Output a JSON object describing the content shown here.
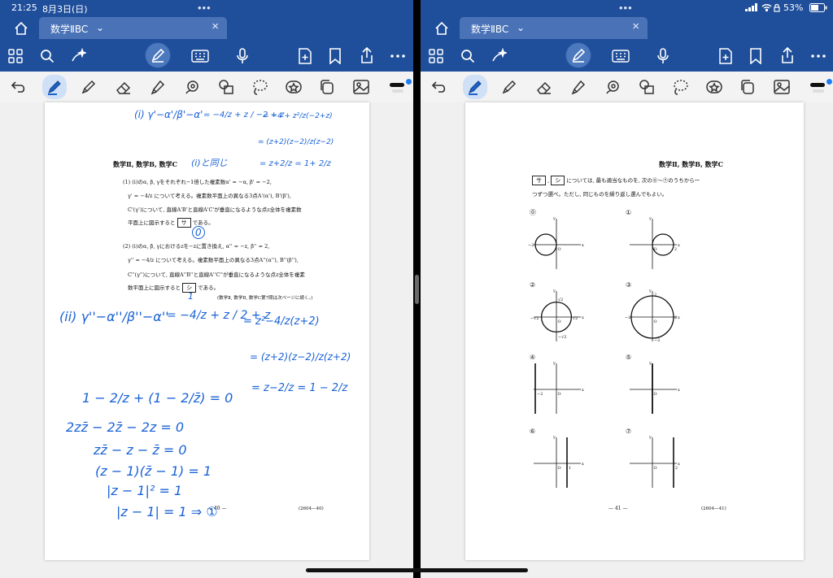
{
  "status_bar": {
    "time": "21:25",
    "date": "8月3日(日)",
    "battery": "53%"
  },
  "document": {
    "tab_title": "数学ⅡBC"
  },
  "left_page": {
    "header": "数学Ⅱ, 数学B, 数学C",
    "q1_line1": "(1) (i)のα, β, γをそれぞれ−1倍した複素数α' = −α, β' = −2,",
    "q1_line2": "γ' = −4/z について考える。複素数平面上の異なる3点A'(α'), B'(β'),",
    "q1_line3": "C'(γ')について, 直線A'B'と直線A'C'が垂直になるような点z全体を複素数",
    "q1_line4": "平面上に図示すると",
    "q1_box": "サ",
    "q1_end": "である。",
    "q2_line1": "(2) (i)のα, β, γにおけるzを−zに置き換え, α'' = −z, β'' = 2,",
    "q2_line2": "γ'' = −4/z について考える。複素数平面上の異なる3点A''(α''), B''(β''),",
    "q2_line3": "C''(γ'')について, 直線A''B''と直線A''C''が垂直になるような点z全体を複素",
    "q2_line4": "数平面上に図示すると",
    "q2_box": "シ",
    "q2_end": "である。",
    "note": "(数学Ⅱ, 数学B, 数学C第7問は次ページに続く。)",
    "page_number": "— 40 —",
    "code": "(2604—40)",
    "handwriting": {
      "top_left": "(i) γ'−α'/β'−α'",
      "top_mid": "= −4/z + z / −2 + z",
      "top_right": "= −4 + z²/z(−2+z)",
      "top_right2": "= (z+2)(z−2)/z(z−2)",
      "top_right3": "= z+2/z = 1+ 2/z",
      "beside_header": "(i)と同じ",
      "circle_answer": "0",
      "circle_answer2": "1",
      "mid_left": "(ii) γ''−α''/β''−α''",
      "mid_eq": "= −4/z + z / 2 + z",
      "mid_right": "= z²−4/z(z+2)",
      "mid_right2": "= (z+2)(z−2)/z(z+2)",
      "mid_right3": "= z−2/z = 1 − 2/z",
      "line1": "1 − 2/z + (1 − 2/z̄) = 0",
      "line2": "2zz̄ − 2z̄ − 2z = 0",
      "line3": "zz̄ − z − z̄ = 0",
      "line4": "(z − 1)(z̄ − 1) = 1",
      "line5": "|z − 1|² = 1",
      "line6": "|z − 1| = 1 ⇒ ①"
    }
  },
  "right_page": {
    "header": "数学Ⅱ, 数学B, 数学C",
    "instr_box1": "サ",
    "instr_box2": "シ",
    "instr_line1": "については, 最も適当なものを, 次の⓪〜⑦のうちから一",
    "instr_line2": "つずつ選べ。ただし, 同じものを繰り返し選んでもよい。",
    "options": [
      {
        "label": "⓪",
        "kind": "circle-left"
      },
      {
        "label": "①",
        "kind": "circle-right"
      },
      {
        "label": "②",
        "kind": "circle-sqrt2"
      },
      {
        "label": "③",
        "kind": "circle-2"
      },
      {
        "label": "④",
        "kind": "line-neg2"
      },
      {
        "label": "⑤",
        "kind": "line-y"
      },
      {
        "label": "⑥",
        "kind": "line-1"
      },
      {
        "label": "⑦",
        "kind": "line-2"
      }
    ],
    "ticks": {
      "neg2": "−2",
      "o": "O",
      "two": "2",
      "sqrt2": "√2",
      "negsqrt2": "−√2",
      "one": "1",
      "x": "x",
      "y": "y"
    },
    "page_number": "— 41 —",
    "code": "(2604—41)"
  },
  "colors": {
    "ribbon": "#1f4e9a",
    "tab": "#4a73b7",
    "ink": "#1a62d6",
    "accent": "#1e7cf0"
  }
}
